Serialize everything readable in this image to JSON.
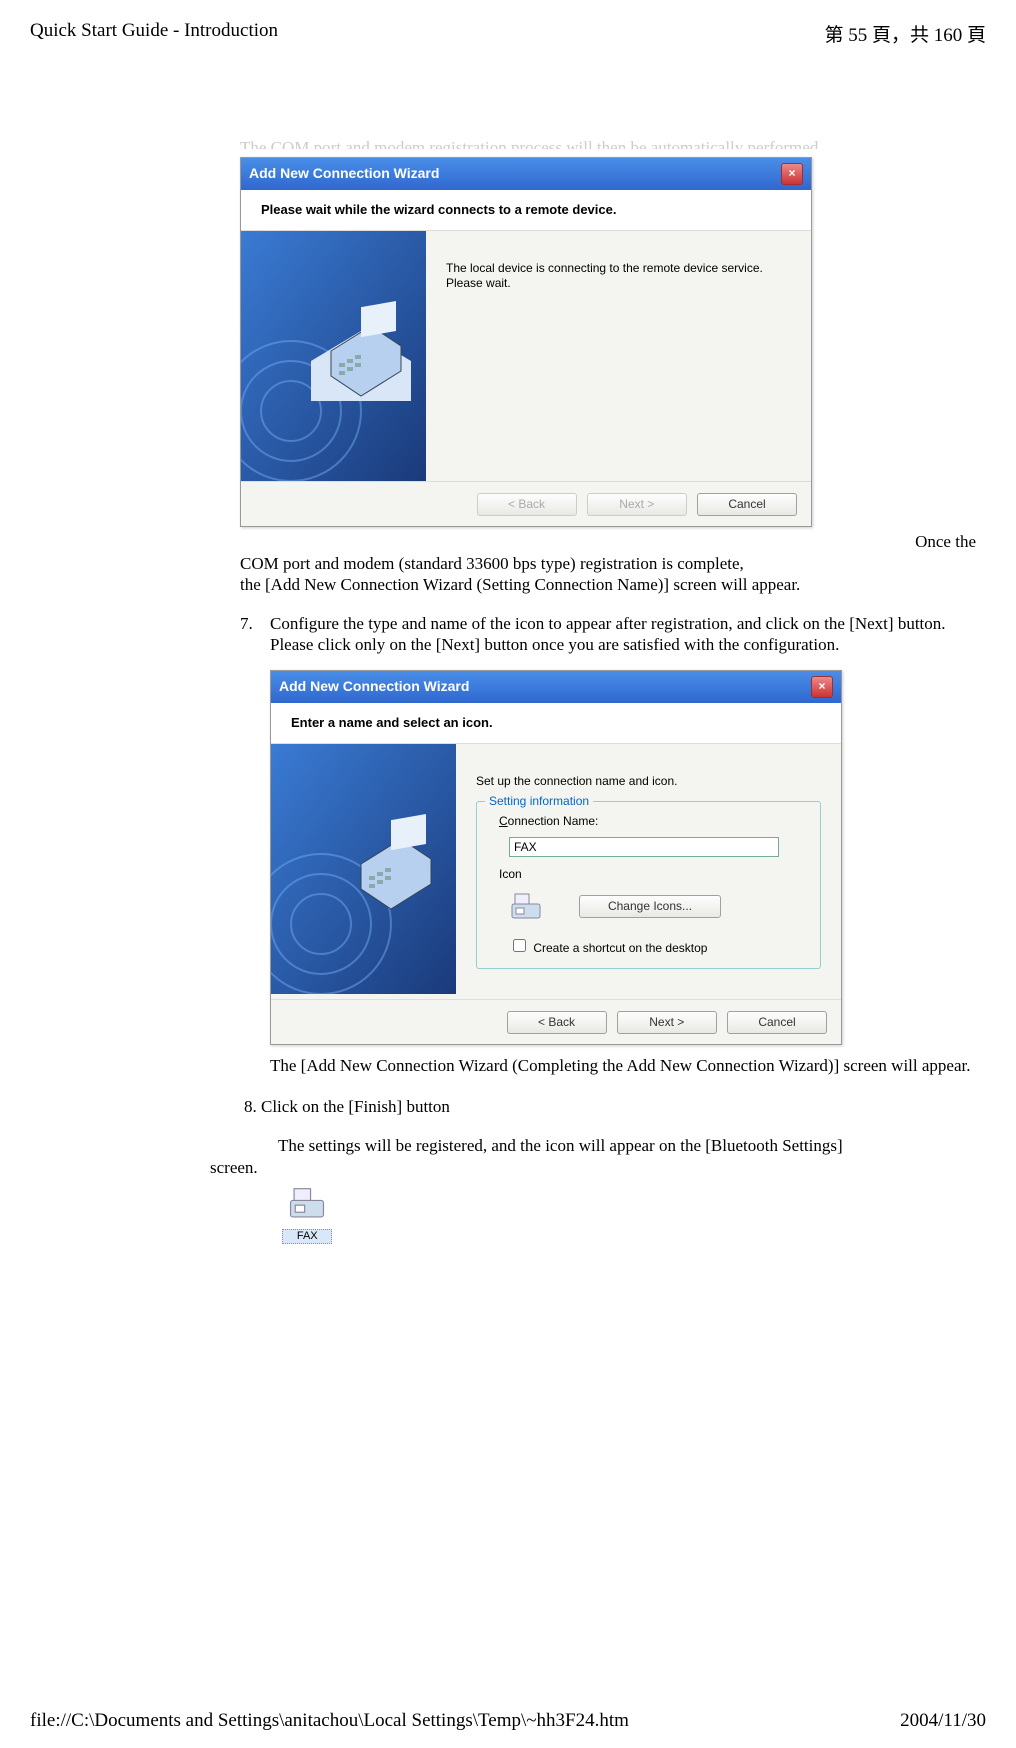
{
  "header": {
    "title": "Quick Start Guide - Introduction",
    "page_info_prefix": "第 ",
    "page_current": "55",
    "page_info_mid": " 頁，共 ",
    "page_total": "160",
    "page_info_suffix": " 頁"
  },
  "partial_top_line": "The COM port and modem registration process will then be automatically performed.",
  "dialog1": {
    "title": "Add New Connection Wizard",
    "subheader": "Please wait while the wizard connects to a remote device.",
    "message_line1": "The local device is connecting to the remote device service.",
    "message_line2": "Please wait.",
    "back": "< Back",
    "next": "Next >",
    "cancel": "Cancel"
  },
  "after_dialog1_tail": "Once the",
  "after_dialog1_line1": "COM port and modem (standard 33600 bps type) registration is complete,",
  "after_dialog1_line2": "the [Add New Connection Wizard (Setting Connection Name)] screen will appear.",
  "step7": {
    "num": "7.",
    "line1": "Configure the type and name of the icon to appear after registration, and click on the [Next] button.",
    "line2": "Please click only on the [Next] button once you are satisfied with the configuration."
  },
  "dialog2": {
    "title": "Add New Connection Wizard",
    "subheader": "Enter a name and select an icon.",
    "instruction": "Set up the connection name and icon.",
    "legend": "Setting information",
    "conn_label": "Connection Name:",
    "conn_value": "FAX",
    "icon_label": "Icon",
    "change_icons": "Change Icons...",
    "checkbox_label": "Create a shortcut on the desktop",
    "back": "< Back",
    "next": "Next >",
    "cancel": "Cancel"
  },
  "after_dialog2": "The [Add New Connection Wizard (Completing the Add New Connection Wizard)] screen will appear.",
  "step8": {
    "prefix": "　　8. ",
    "text": "Click on the [Finish] button"
  },
  "after_step8": {
    "line1_prefix": "　　　　",
    "line1": "The settings will be registered, and the icon will appear on the [Bluetooth Settings] ",
    "line2": "screen."
  },
  "result_icon_label": "FAX",
  "result_prefix": "　　　　",
  "footer": {
    "path": "file://C:\\Documents and Settings\\anitachou\\Local Settings\\Temp\\~hh3F24.htm",
    "date": "2004/11/30"
  }
}
